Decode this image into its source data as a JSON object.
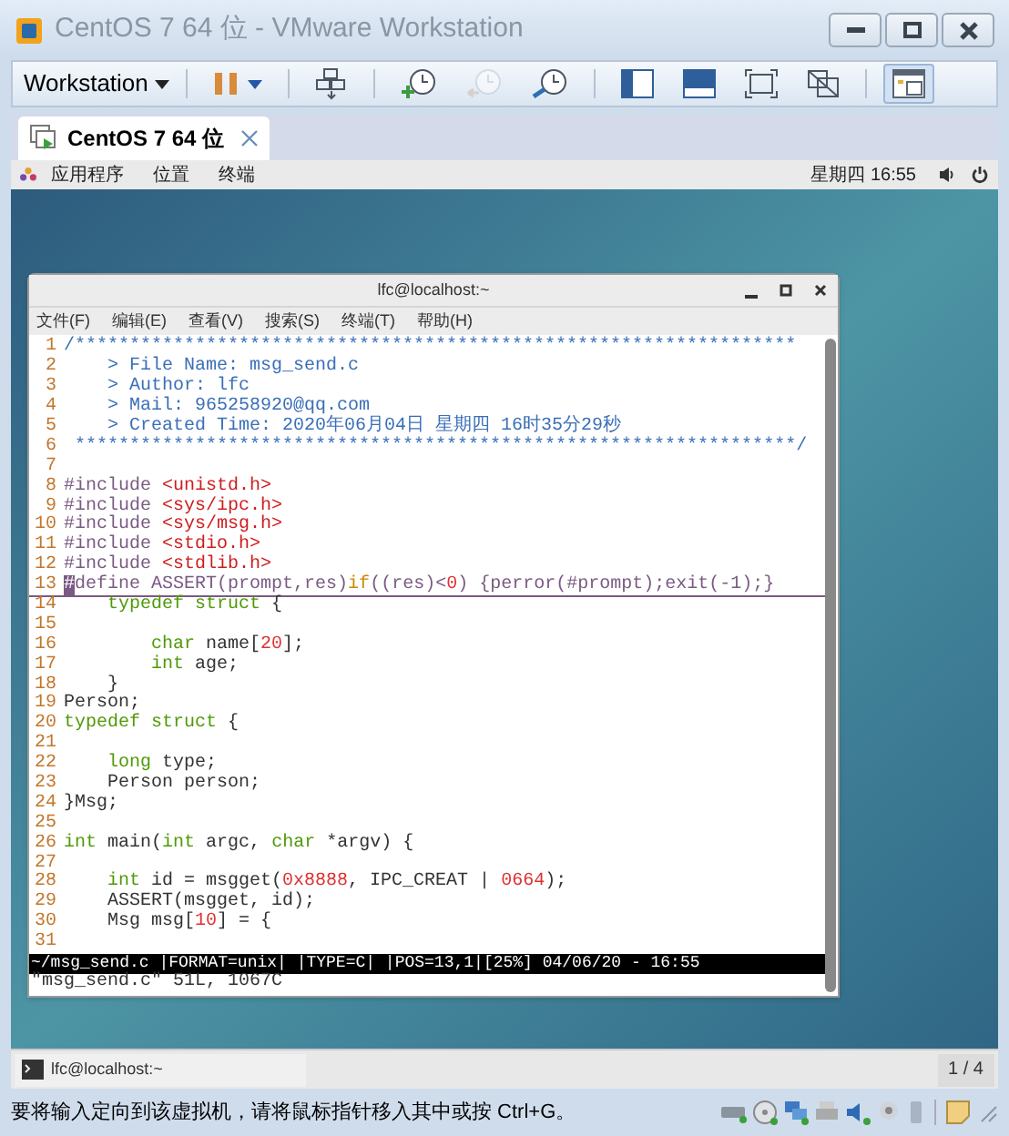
{
  "window": {
    "title": "CentOS 7 64 位 - VMware Workstation"
  },
  "toolbar": {
    "menu_label": "Workstation",
    "buttons": [
      {
        "kind": "pause",
        "selected": false,
        "disabled": false
      },
      {
        "kind": "send-keys",
        "selected": false,
        "disabled": false
      },
      {
        "kind": "snapshot",
        "selected": false,
        "disabled": false
      },
      {
        "kind": "revert",
        "selected": false,
        "disabled": true
      },
      {
        "kind": "manager",
        "selected": false,
        "disabled": false
      },
      {
        "kind": "sidebar",
        "selected": false,
        "disabled": false
      },
      {
        "kind": "console",
        "selected": false,
        "disabled": false
      },
      {
        "kind": "fullscreen",
        "selected": false,
        "disabled": false
      },
      {
        "kind": "unity",
        "selected": false,
        "disabled": false
      },
      {
        "kind": "thumbnail",
        "selected": true,
        "disabled": false
      }
    ]
  },
  "tabs": [
    {
      "label": "CentOS 7 64 位",
      "selected": true
    }
  ],
  "guest_top_bar": {
    "menus": [
      "应用程序",
      "位置",
      "终端"
    ],
    "clock": "星期四 16:55"
  },
  "terminal": {
    "title": "lfc@localhost:~",
    "menu": [
      "文件(F)",
      "编辑(E)",
      "查看(V)",
      "搜索(S)",
      "终端(T)",
      "帮助(H)"
    ],
    "lines": [
      {
        "num": "1",
        "current": false,
        "segments": [
          {
            "kind": "comment",
            "text": "/******************************************************************"
          }
        ]
      },
      {
        "num": "2",
        "current": false,
        "segments": [
          {
            "kind": "comment",
            "text": "    > File Name: msg_send.c"
          }
        ]
      },
      {
        "num": "3",
        "current": false,
        "segments": [
          {
            "kind": "comment",
            "text": "    > Author: lfc"
          }
        ]
      },
      {
        "num": "4",
        "current": false,
        "segments": [
          {
            "kind": "comment",
            "text": "    > Mail: 965258920@qq.com"
          }
        ]
      },
      {
        "num": "5",
        "current": false,
        "segments": [
          {
            "kind": "comment",
            "text": "    > Created Time: 2020年06月04日 星期四 16时35分29秒"
          }
        ]
      },
      {
        "num": "6",
        "current": false,
        "segments": [
          {
            "kind": "comment",
            "text": " ******************************************************************/"
          }
        ]
      },
      {
        "num": "7",
        "current": false
      },
      {
        "num": "8",
        "current": false,
        "segments": [
          {
            "kind": "preproc",
            "text": "#include "
          },
          {
            "kind": "string",
            "text": "<unistd.h>"
          }
        ]
      },
      {
        "num": "9",
        "current": false,
        "segments": [
          {
            "kind": "preproc",
            "text": "#include "
          },
          {
            "kind": "string",
            "text": "<sys/ipc.h>"
          }
        ]
      },
      {
        "num": "10",
        "current": false,
        "segments": [
          {
            "kind": "preproc",
            "text": "#include "
          },
          {
            "kind": "string",
            "text": "<sys/msg.h>"
          }
        ]
      },
      {
        "num": "11",
        "current": false,
        "segments": [
          {
            "kind": "preproc",
            "text": "#include "
          },
          {
            "kind": "string",
            "text": "<stdio.h>"
          }
        ]
      },
      {
        "num": "12",
        "current": false,
        "segments": [
          {
            "kind": "preproc",
            "text": "#include "
          },
          {
            "kind": "string",
            "text": "<stdlib.h>"
          }
        ]
      },
      {
        "num": "13",
        "current": true,
        "segments": [
          {
            "kind": "cursor",
            "text": "#"
          },
          {
            "kind": "preproc",
            "text": "define ASSERT(prompt,res)"
          },
          {
            "kind": "keyword",
            "text": "if"
          },
          {
            "kind": "preproc",
            "text": "((res)<"
          },
          {
            "kind": "number",
            "text": "0"
          },
          {
            "kind": "preproc",
            "text": ") {perror(#prompt);exit(-1);}"
          }
        ]
      },
      {
        "num": "14",
        "current": false,
        "segments": [
          {
            "kind": "type",
            "text": "    typedef struct"
          },
          {
            "kind": "plain",
            "text": " {"
          }
        ]
      },
      {
        "num": "15",
        "current": false
      },
      {
        "num": "16",
        "current": false,
        "segments": [
          {
            "kind": "type",
            "text": "        char"
          },
          {
            "kind": "plain",
            "text": " name["
          },
          {
            "kind": "number",
            "text": "20"
          },
          {
            "kind": "plain",
            "text": "];"
          }
        ]
      },
      {
        "num": "17",
        "current": false,
        "segments": [
          {
            "kind": "type",
            "text": "        int"
          },
          {
            "kind": "plain",
            "text": " age;"
          }
        ]
      },
      {
        "num": "18",
        "current": false,
        "segments": [
          {
            "kind": "plain",
            "text": "    }"
          }
        ]
      },
      {
        "num": "19",
        "current": false,
        "segments": [
          {
            "kind": "plain",
            "text": "Person;"
          }
        ]
      },
      {
        "num": "20",
        "current": false,
        "segments": [
          {
            "kind": "type",
            "text": "typedef struct"
          },
          {
            "kind": "plain",
            "text": " {"
          }
        ]
      },
      {
        "num": "21",
        "current": false
      },
      {
        "num": "22",
        "current": false,
        "segments": [
          {
            "kind": "type",
            "text": "    long"
          },
          {
            "kind": "plain",
            "text": " type;"
          }
        ]
      },
      {
        "num": "23",
        "current": false,
        "segments": [
          {
            "kind": "plain",
            "text": "    Person person;"
          }
        ]
      },
      {
        "num": "24",
        "current": false,
        "segments": [
          {
            "kind": "plain",
            "text": "}Msg;"
          }
        ]
      },
      {
        "num": "25",
        "current": false
      },
      {
        "num": "26",
        "current": false,
        "segments": [
          {
            "kind": "type",
            "text": "int"
          },
          {
            "kind": "plain",
            "text": " main("
          },
          {
            "kind": "type",
            "text": "int"
          },
          {
            "kind": "plain",
            "text": " argc, "
          },
          {
            "kind": "type",
            "text": "char"
          },
          {
            "kind": "plain",
            "text": " *argv) {"
          }
        ]
      },
      {
        "num": "27",
        "current": false
      },
      {
        "num": "28",
        "current": false,
        "segments": [
          {
            "kind": "type",
            "text": "    int"
          },
          {
            "kind": "plain",
            "text": " id = msgget("
          },
          {
            "kind": "number",
            "text": "0x8888"
          },
          {
            "kind": "plain",
            "text": ", IPC_CREAT | "
          },
          {
            "kind": "number",
            "text": "0664"
          },
          {
            "kind": "plain",
            "text": ");"
          }
        ]
      },
      {
        "num": "29",
        "current": false,
        "segments": [
          {
            "kind": "plain",
            "text": "    ASSERT(msgget, id);"
          }
        ]
      },
      {
        "num": "30",
        "current": false,
        "segments": [
          {
            "kind": "plain",
            "text": "    Msg msg["
          },
          {
            "kind": "number",
            "text": "10"
          },
          {
            "kind": "plain",
            "text": "] = {"
          }
        ]
      },
      {
        "num": "31",
        "current": false
      }
    ],
    "status_line": "~/msg_send.c |FORMAT=unix| |TYPE=C| |POS=13,1|[25%] 04/06/20 - 16:55",
    "message": "\"msg_send.c\" 51L, 1067C"
  },
  "taskbar": {
    "window_button": "lfc@localhost:~",
    "workspace": "1 / 4"
  },
  "status_bar": {
    "message": "要将输入定向到该虚拟机，请将鼠标指针移入其中或按 Ctrl+G。"
  }
}
